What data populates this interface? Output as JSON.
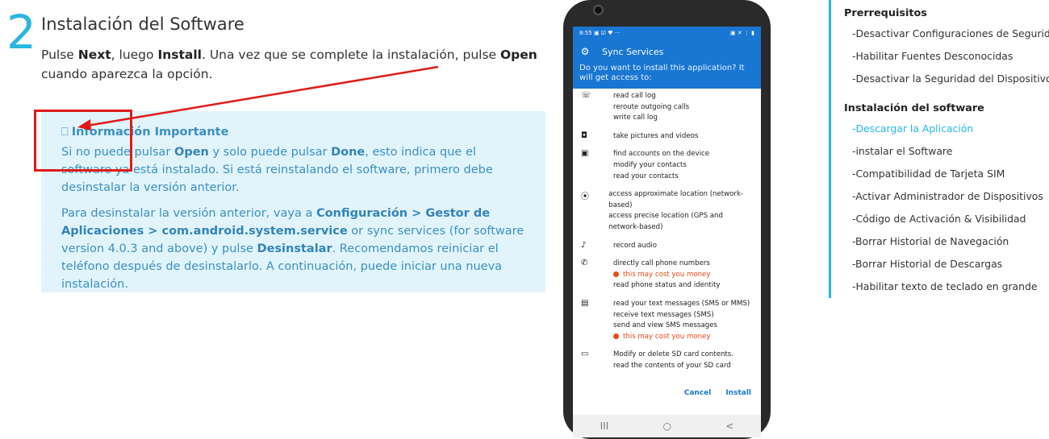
{
  "step": {
    "number": "2",
    "title": "Instalación del Software",
    "desc_1": "Pulse ",
    "desc_next": "Next",
    "desc_2": ", luego ",
    "desc_install": "Install",
    "desc_3": ". Una vez que se complete la instalación, pulse ",
    "desc_open": "Open",
    "desc_4": " cuando aparezca la opción."
  },
  "info": {
    "glyph": "⎕",
    "title": "Información Importante",
    "p1_a": "Si no puede pulsar ",
    "p1_open": "Open",
    "p1_b": " y solo puede pulsar ",
    "p1_done": "Done",
    "p1_c": ", esto indica que el software ya está instalado. Si está reinstalando el software, primero debe desinstalar la versión anterior.",
    "p2_a": "Para desinstalar la versión anterior, vaya a ",
    "p2_path": "Configuración > Gestor de Aplicaciones > com.android.system.service",
    "p2_b": " or sync services (for software version 4.0.3 and above) y pulse ",
    "p2_uninstall": "Desinstalar",
    "p2_c": ". Recomendamos reiniciar el teléfono después de desinstalarlo. A continuación, puede iniciar una nueva instalación."
  },
  "phone": {
    "time": "8:55",
    "status_icons_left": "▣ ☑ ♥ ···",
    "status_icons_right": "▣ ✕ ⋮ ▮",
    "app_title": "Sync Services",
    "question": "Do you want to install this application? It will get access to:",
    "permissions": [
      {
        "icon": "☏",
        "lines": [
          "read call log",
          "reroute outgoing calls",
          "write call log"
        ]
      },
      {
        "icon": "◘",
        "lines": [
          "take pictures and videos"
        ]
      },
      {
        "icon": "▣",
        "lines": [
          "find accounts on the device",
          "modify your contacts",
          "read your contacts"
        ]
      },
      {
        "icon": "⦿",
        "lines": [
          "access approximate location (network-based)",
          "access precise location (GPS and network-based)"
        ]
      },
      {
        "icon": "♪",
        "lines": [
          "record audio"
        ]
      },
      {
        "icon": "✆",
        "lines": [
          "directly call phone numbers"
        ],
        "cost": "this may cost you money",
        "after": [
          "read phone status and identity"
        ]
      },
      {
        "icon": "▤",
        "lines": [
          "read your text messages (SMS or MMS)",
          "receive text messages (SMS)",
          "send and view SMS messages"
        ],
        "cost": "this may cost you money"
      },
      {
        "icon": "▭",
        "lines": [
          "Modify or delete SD card contents.",
          "read the contents of your SD card"
        ]
      }
    ],
    "cancel": "Cancel",
    "install": "Install",
    "nav_recent": "III",
    "nav_home": "○",
    "nav_back": "<"
  },
  "toc": {
    "section1": "Prerrequisitos",
    "items1": [
      "-Desactivar Configuraciones de Seguridad",
      "-Habilitar Fuentes Desconocidas",
      "-Desactivar la Seguridad del Dispositivo"
    ],
    "section2": "Instalación del software",
    "items2": [
      "-Descargar la Aplicación",
      "-instalar el Software",
      "-Compatibilidad de Tarjeta SIM",
      "-Activar Administrador de Dispositivos",
      "-Código de Activación & Visibilidad",
      "-Borrar Historial de Navegación",
      "-Borrar Historial de Descargas",
      "-Habilitar texto de teclado en grande"
    ],
    "active_index": 0
  },
  "colors": {
    "accent": "#29b6e0",
    "info_bg": "#e1f4fc",
    "info_text": "#3d8fbf",
    "annotation": "#e01a1a",
    "android_blue": "#1976d2",
    "cost": "#e64a19"
  }
}
